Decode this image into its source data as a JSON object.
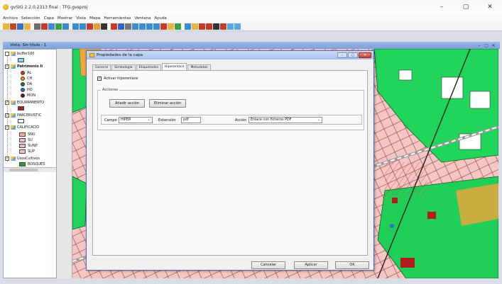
{
  "window": {
    "title": "gvSIG 2.2.0.2313 final : TFG.gvsproj",
    "buttons": [
      "–",
      "▢",
      "✕"
    ]
  },
  "menu": [
    "Archivo",
    "Selección",
    "Capa",
    "Mostrar",
    "Vista",
    "Mapa",
    "Herramientas",
    "Ventana",
    "Ayuda"
  ],
  "toolbar_colors": [
    "#e9b340",
    "#c04a2a",
    "#3c6fc4",
    "#e9b340",
    "#6b6b6b",
    "#c53a2a",
    "#3b8bd0",
    "#3aa045",
    "#3b8bd0",
    "#3b8bd0",
    "#3b8bd0",
    "#c53a2a",
    "#e0a03a",
    "#333333",
    "#c53a2a",
    "#2f66c6",
    "#777777",
    "#3b8bd0",
    "#3b8bd0",
    "#3b8bd0",
    "#3b8bd0",
    "#c53a2a",
    "#e9b340",
    "#3aa045",
    "#3b8bd0",
    "#e9b340",
    "#c53a2a",
    "#c53a2a",
    "#333333",
    "#c53a2a",
    "#5aa7df",
    "#5aa7df"
  ],
  "view": {
    "title": "Vista: Sin título - 1",
    "buttons": [
      "–",
      "▢",
      "✕"
    ]
  },
  "toc": {
    "layers": [
      {
        "name": "buffer100",
        "checked": false,
        "swatch": "#8ad3e8"
      },
      {
        "name": "Patrimonio Ii",
        "checked": true,
        "bold": true,
        "items": [
          {
            "label": "AL",
            "color": "#e8291b"
          },
          {
            "label": "CH",
            "color": "#f08a1c"
          },
          {
            "label": "DA",
            "color": "#1a7a3a"
          },
          {
            "label": "HO",
            "color": "#2d6fd0"
          },
          {
            "label": "MON",
            "color": "#7a1010"
          }
        ]
      },
      {
        "name": "EQUIPAMIENTO",
        "checked": true,
        "swatch": "#b01e1e"
      },
      {
        "name": "PARCERUSTIC",
        "checked": true,
        "swatch": "#ffffff"
      },
      {
        "name": "CALIFICACIO",
        "checked": true,
        "items": [
          {
            "label": "SNU",
            "color": "#f0ab9e"
          },
          {
            "label": "SU",
            "color": "#f6b9c4"
          },
          {
            "label": "SUNP",
            "color": "#e6b5d8"
          },
          {
            "label": "SUP",
            "color": "#f5c3c0"
          }
        ]
      },
      {
        "name": "UsosCultivos",
        "checked": true,
        "items": [
          {
            "label": "BOSQUES",
            "color": "#2e9c3a"
          }
        ]
      }
    ]
  },
  "dialog": {
    "title": "Propiedades de la capa",
    "title_buttons": [
      "–",
      "▢",
      "✕"
    ],
    "tabs": [
      "General",
      "Simbología",
      "Etiquetados",
      "Hiperenlace",
      "Metadatos"
    ],
    "active_tab": "Hiperenlace",
    "activate_label": "Activar hiperenlace",
    "activate_checked": true,
    "group_label": "Acciones",
    "add_action": "Añadir acción",
    "remove_action": "Eliminar acción",
    "campo_label": "Campo",
    "campo_value": "HIPER",
    "extension_label": "Extensión",
    "extension_value": "pdf",
    "accion_label": "Acción",
    "accion_value": "Enlace con ficheros PDF",
    "cancel": "Cancelar",
    "apply": "Aplicar",
    "ok": "OK"
  }
}
